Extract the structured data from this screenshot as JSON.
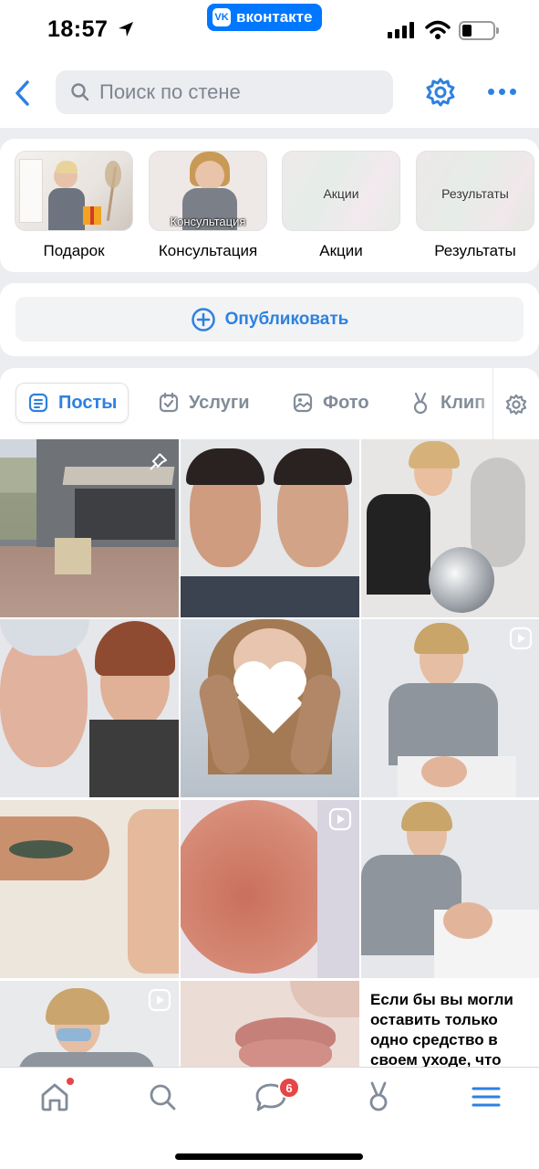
{
  "status_bar": {
    "time": "18:57",
    "app_badge": "вконтакте"
  },
  "header": {
    "search_placeholder": "Поиск по стене"
  },
  "stories": [
    {
      "label": "Подарок",
      "overlay": ""
    },
    {
      "label": "Консультация",
      "overlay": "Консультация"
    },
    {
      "label": "Акции",
      "overlay": "Акции"
    },
    {
      "label": "Результаты",
      "overlay": "Результаты"
    }
  ],
  "publish": {
    "label": "Опубликовать"
  },
  "tabs": [
    {
      "label": "Посты",
      "active": true
    },
    {
      "label": "Услуги"
    },
    {
      "label": "Фото"
    },
    {
      "label": "Клип"
    }
  ],
  "grid": {
    "text_post": "Если бы вы могли оставить только одно средство в своем уходе, что"
  },
  "tabbar": {
    "messages_badge": "6"
  },
  "colors": {
    "accent": "#2d81e0",
    "vk_blue": "#0077ff",
    "badge_red": "#e64646"
  }
}
